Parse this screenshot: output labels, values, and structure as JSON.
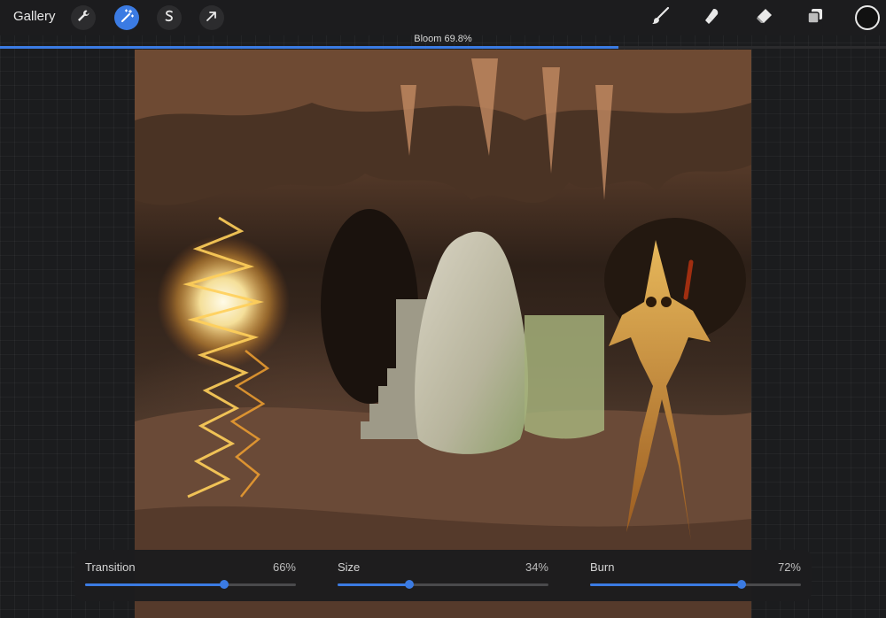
{
  "toolbar": {
    "gallery_label": "Gallery",
    "left_tools": [
      {
        "icon": "wrench-icon",
        "state": "normal"
      },
      {
        "icon": "magic-wand-icon",
        "state": "active"
      },
      {
        "icon": "selection-s-icon",
        "state": "normal"
      },
      {
        "icon": "arrow-cursor-icon",
        "state": "normal"
      }
    ],
    "right_tools": [
      "brush-icon",
      "smudge-icon",
      "eraser-icon",
      "layers-icon"
    ],
    "color_swatch": "#111111"
  },
  "effect": {
    "label": "Bloom 69.8%",
    "progress": 0.698,
    "accent": "#3b7be3"
  },
  "sliders": [
    {
      "label": "Transition",
      "value_text": "66%",
      "value": 0.66
    },
    {
      "label": "Size",
      "value_text": "34%",
      "value": 0.34
    },
    {
      "label": "Burn",
      "value_text": "72%",
      "value": 0.72
    }
  ]
}
